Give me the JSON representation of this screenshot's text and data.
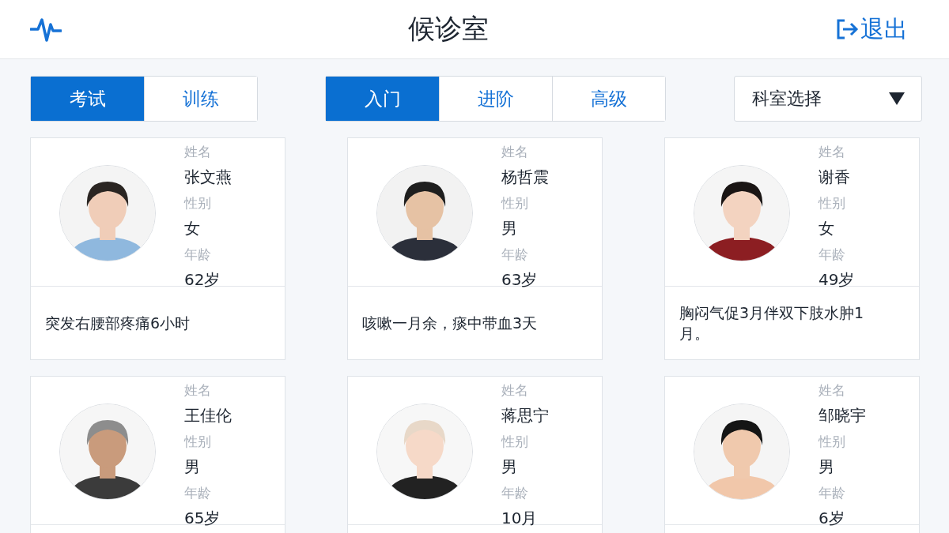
{
  "header": {
    "title": "候诊室",
    "logout": "退出"
  },
  "mode_tabs": [
    {
      "label": "考试",
      "selected": true
    },
    {
      "label": "训练",
      "selected": false
    }
  ],
  "level_tabs": [
    {
      "label": "入门",
      "selected": true
    },
    {
      "label": "进阶",
      "selected": false
    },
    {
      "label": "高级",
      "selected": false
    }
  ],
  "department_select": {
    "placeholder": "科室选择"
  },
  "patients": [
    {
      "name_label": "姓名",
      "name": "张文燕",
      "gender_label": "性别",
      "gender": "女",
      "age_label": "年龄",
      "age": "62岁",
      "complaint": "突发右腰部疼痛6小时"
    },
    {
      "name_label": "姓名",
      "name": "杨哲震",
      "gender_label": "性别",
      "gender": "男",
      "age_label": "年龄",
      "age": "63岁",
      "complaint": "咳嗽一月余，痰中带血3天"
    },
    {
      "name_label": "姓名",
      "name": "谢香",
      "gender_label": "性别",
      "gender": "女",
      "age_label": "年龄",
      "age": "49岁",
      "complaint": "胸闷气促3月伴双下肢水肿1月。"
    },
    {
      "name_label": "姓名",
      "name": "王佳伦",
      "gender_label": "性别",
      "gender": "男",
      "age_label": "年龄",
      "age": "65岁"
    },
    {
      "name_label": "姓名",
      "name": "蒋思宁",
      "gender_label": "性别",
      "gender": "男",
      "age_label": "年龄",
      "age": "10月"
    },
    {
      "name_label": "姓名",
      "name": "邹晓宇",
      "gender_label": "性别",
      "gender": "男",
      "age_label": "年龄",
      "age": "6岁"
    }
  ]
}
